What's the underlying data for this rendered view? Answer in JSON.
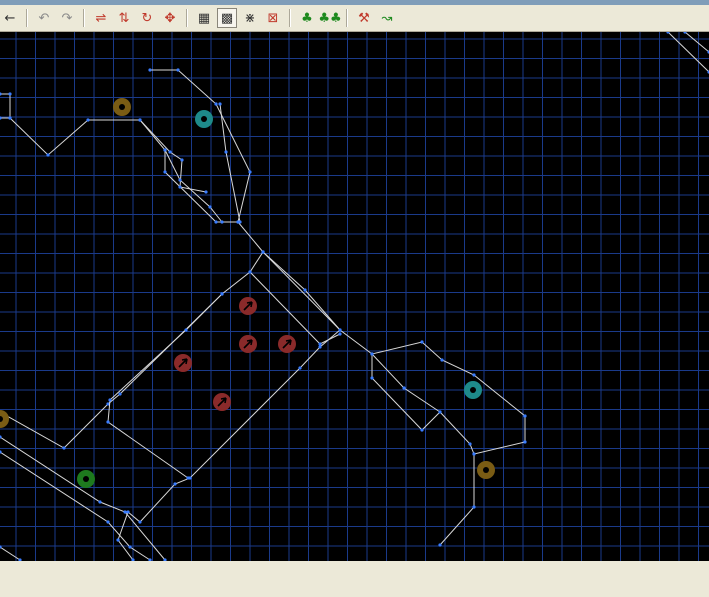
{
  "window": {
    "title": ""
  },
  "toolbar": {
    "groups": [
      [
        {
          "name": "back-arrow-icon",
          "glyph": "←",
          "color": "#333333"
        }
      ],
      [
        {
          "name": "undo-icon",
          "glyph": "↶",
          "color": "#8a8a8a"
        },
        {
          "name": "redo-icon",
          "glyph": "↷",
          "color": "#8a8a8a"
        }
      ],
      [
        {
          "name": "flip-horizontal-icon",
          "glyph": "⇌",
          "color": "#c0392b"
        },
        {
          "name": "flip-vertical-icon",
          "glyph": "⇅",
          "color": "#c0392b"
        },
        {
          "name": "rotate-icon",
          "glyph": "↻",
          "color": "#c0392b"
        },
        {
          "name": "move-icon",
          "glyph": "✥",
          "color": "#c0392b"
        }
      ],
      [
        {
          "name": "grid-icon",
          "glyph": "▦",
          "color": "#333333"
        },
        {
          "name": "grid-snap-icon",
          "glyph": "▩",
          "color": "#333333",
          "active": true
        },
        {
          "name": "merge-points-icon",
          "glyph": "⋇",
          "color": "#333333"
        },
        {
          "name": "close-map-icon",
          "glyph": "⊠",
          "color": "#c0392b"
        }
      ],
      [
        {
          "name": "tree-icon",
          "glyph": "♣",
          "color": "#1e8a1e"
        },
        {
          "name": "trees-icon",
          "glyph": "♣♣",
          "color": "#1e8a1e"
        }
      ],
      [
        {
          "name": "tools-icon",
          "glyph": "⚒",
          "color": "#c0392b"
        },
        {
          "name": "path-icon",
          "glyph": "↝",
          "color": "#1e8a1e"
        }
      ]
    ]
  },
  "map": {
    "background": "#000000",
    "grid_color": "#1a3a8a",
    "wall_color": "#d8d8d8",
    "vertex_color": "#3a7dff",
    "things": [
      {
        "type": "ring",
        "color": "#7a5c14"
      },
      {
        "type": "ring",
        "color": "#1e8a8a"
      },
      {
        "type": "ring",
        "color": "#1e8a8a"
      },
      {
        "type": "ring",
        "color": "#7a5c14"
      },
      {
        "type": "ring",
        "color": "#7a5c14"
      },
      {
        "type": "ring",
        "color": "#1e7a1e"
      },
      {
        "type": "arrow",
        "color": "#8a2a2a"
      },
      {
        "type": "arrow",
        "color": "#8a2a2a"
      },
      {
        "type": "arrow",
        "color": "#8a2a2a"
      },
      {
        "type": "arrow",
        "color": "#8a2a2a"
      },
      {
        "type": "arrow",
        "color": "#8a2a2a"
      }
    ]
  }
}
